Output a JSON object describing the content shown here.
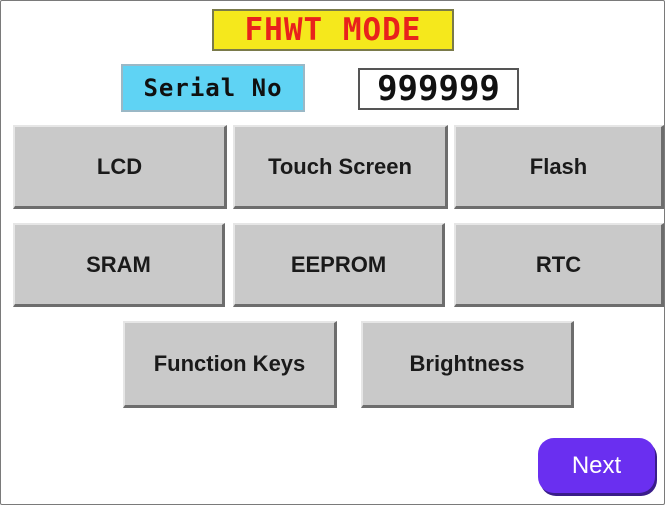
{
  "header": {
    "title": "FHWT MODE"
  },
  "serial": {
    "label": "Serial No",
    "value": "999999"
  },
  "tests": {
    "lcd": "LCD",
    "touch_screen": "Touch Screen",
    "flash": "Flash",
    "sram": "SRAM",
    "eeprom": "EEPROM",
    "rtc": "RTC",
    "function_keys": "Function Keys",
    "brightness": "Brightness"
  },
  "navigation": {
    "next": "Next"
  },
  "colors": {
    "title_background": "#f5e81c",
    "title_text": "#e8221c",
    "serial_label_background": "#5fd3f4",
    "button_face": "#c9c9c9",
    "next_button": "#6a2ff0"
  }
}
